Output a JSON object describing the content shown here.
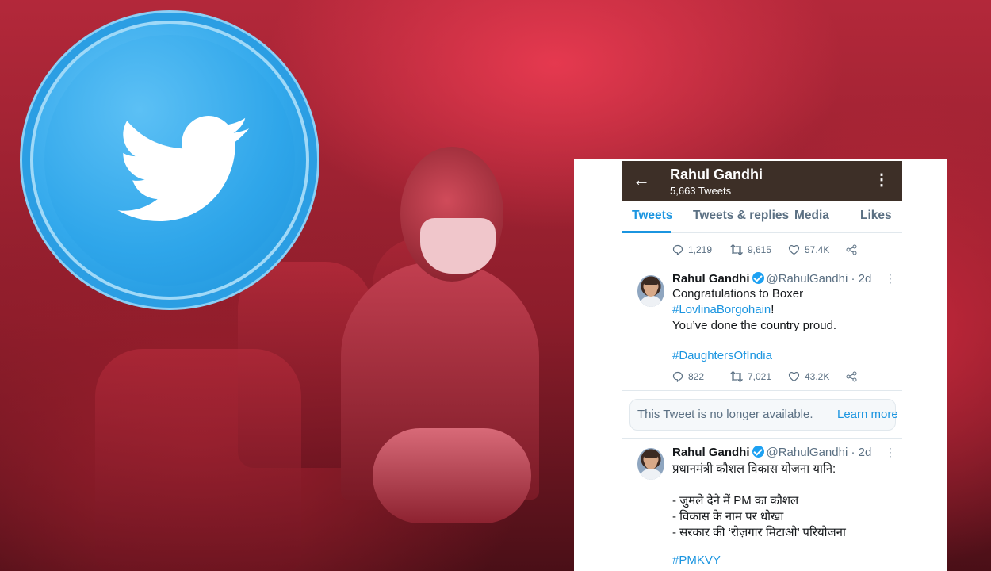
{
  "profile": {
    "name": "Rahul Gandhi",
    "tweet_count": "5,663 Tweets"
  },
  "tabs": [
    "Tweets",
    "Tweets & replies",
    "Media",
    "Likes"
  ],
  "top_tweet_actions": {
    "replies": "1,219",
    "retweets": "9,615",
    "likes": "57.4K"
  },
  "tweet1": {
    "name": "Rahul Gandhi",
    "handle": "@RahulGandhi",
    "time": "· 2d",
    "lines": [
      "Congratulations to Boxer",
      "#LovlinaBorgohain",
      "!",
      "You’ve done the country proud.",
      "#DaughtersOfIndia"
    ],
    "replies": "822",
    "retweets": "7,021",
    "likes": "43.2K"
  },
  "unavailable": {
    "text": "This Tweet is no longer available.",
    "link": "Learn more"
  },
  "tweet2": {
    "name": "Rahul Gandhi",
    "handle": "@RahulGandhi",
    "time": "· 2d",
    "lines": [
      "प्रधानमंत्री कौशल विकास योजना यानि:",
      "- जुमले देने में PM का कौशल",
      "- विकास के नाम पर धोखा",
      "- सरकार की ‘रोज़गार मिटाओ’ परियोजना",
      "#PMKVY"
    ]
  },
  "icons": {
    "back": "arrow-left-icon",
    "menu": "kebab-icon",
    "brand": "twitter-bird-icon"
  },
  "colors": {
    "twitter_blue": "#1da1f2",
    "link": "#1b95e0",
    "appbar": "#3d2f27"
  }
}
